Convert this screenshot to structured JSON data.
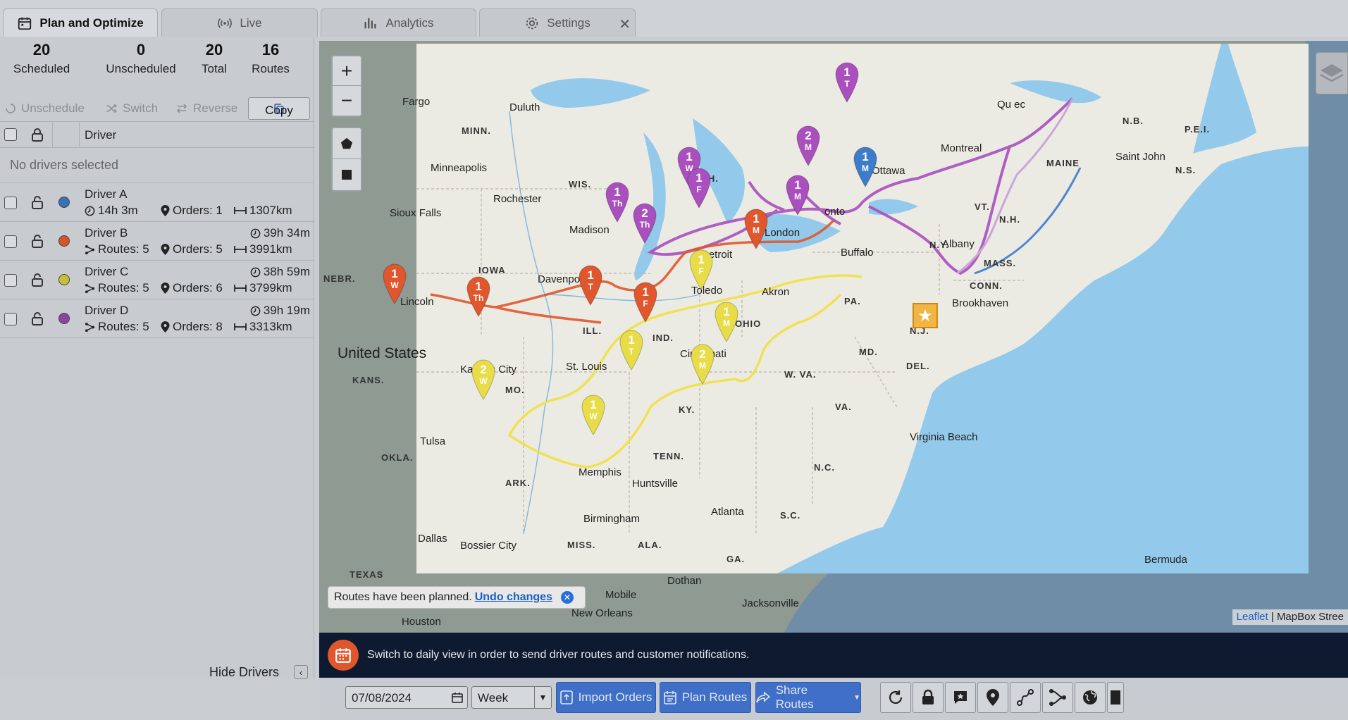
{
  "tabs": [
    {
      "label": "Plan and Optimize",
      "icon": "calendar-icon"
    },
    {
      "label": "Live",
      "icon": "broadcast-icon"
    },
    {
      "label": "Analytics",
      "icon": "bar-chart-icon"
    },
    {
      "label": "Settings",
      "icon": "gear-icon"
    }
  ],
  "stats": [
    {
      "value": "20",
      "label": "Scheduled"
    },
    {
      "value": "0",
      "label": "Unscheduled"
    },
    {
      "value": "20",
      "label": "Total"
    },
    {
      "value": "16",
      "label": "Routes"
    }
  ],
  "actions": {
    "unschedule": "Unschedule",
    "switch": "Switch",
    "reverse": "Reverse",
    "copy": "Copy"
  },
  "table": {
    "driver_header": "Driver",
    "no_selection": "No drivers selected"
  },
  "drivers": [
    {
      "name": "Driver A",
      "color": "#3b6fb6",
      "time": "14h 3m",
      "orders": "Orders: 1",
      "distance": "1307km",
      "routes": ""
    },
    {
      "name": "Driver B",
      "color": "#d6542c",
      "time": "39h 34m",
      "orders": "Orders: 5",
      "distance": "3991km",
      "routes": "Routes: 5"
    },
    {
      "name": "Driver C",
      "color": "#c9be3a",
      "time": "38h 59m",
      "orders": "Orders: 6",
      "distance": "3799km",
      "routes": "Routes: 5"
    },
    {
      "name": "Driver D",
      "color": "#8e43a3",
      "time": "39h 19m",
      "orders": "Orders: 8",
      "distance": "3313km",
      "routes": "Routes: 5"
    }
  ],
  "hide_drivers": "Hide Drivers",
  "map": {
    "zoom_in": "+",
    "zoom_out": "−",
    "country_label": "United States",
    "toast_text": "Routes have been planned.",
    "toast_link": "Undo changes",
    "attribution_link": "Leaflet",
    "attribution_text": "| MapBox Stree",
    "labels": {
      "fargo": "Fargo",
      "duluth": "Duluth",
      "minn": "MINN.",
      "minneapolis": "Minneapolis",
      "wis": "WIS.",
      "mich": "MICH.",
      "rochester": "Rochester",
      "madison": "Madison",
      "sioux_falls": "Sioux Falls",
      "iowa": "IOWA",
      "davenport": "Davenport",
      "nebr": "NEBR.",
      "lincoln": "Lincoln",
      "ill": "ILL.",
      "ind": "IND.",
      "ohio": "OHIO",
      "detroit": "Detroit",
      "toledo": "Toledo",
      "akron": "Akron",
      "london": "London",
      "toronto": "onto",
      "buffalo": "Buffalo",
      "ottawa": "Ottawa",
      "montreal": "Montreal",
      "quebec": "Qu  ec",
      "maine": "MAINE",
      "nb": "N.B.",
      "pei": "P.E.I.",
      "saint_john": "Saint John",
      "ns": "N.S.",
      "vt": "VT.",
      "nh": "N.H.",
      "ny": "N.Y.",
      "albany": "Albany",
      "mass": "MASS.",
      "conn": "CONN.",
      "brookhaven": "Brookhaven",
      "pa": "PA.",
      "nj": "N.J.",
      "md": "MD.",
      "del": "DEL.",
      "wva": "W. VA.",
      "va": "VA.",
      "kansas_city": "Kansas City",
      "kans": "KANS.",
      "mo": "MO.",
      "st_louis": "St. Louis",
      "cincinnati": "Cincinnati",
      "ky": "KY.",
      "tenn": "TENN.",
      "tulsa": "Tulsa",
      "okla": "OKLA.",
      "ark": "ARK.",
      "memphis": "Memphis",
      "huntsville": "Huntsville",
      "birmingham": "Birmingham",
      "atlanta": "Atlanta",
      "nc": "N.C.",
      "sc": "S.C.",
      "virginia_beach": "Virginia Beach",
      "dallas": "Dallas",
      "bossier_city": "Bossier City",
      "miss": "MISS.",
      "ala": "ALA.",
      "ga": "GA.",
      "texas": "TEXAS",
      "dothan": "Dothan",
      "mobile": "Mobile",
      "jacksonville": "Jacksonville",
      "houston": "Houston",
      "new_orleans": "New Orleans",
      "bermuda": "Bermuda"
    },
    "markers": [
      {
        "num": "1",
        "day": "T",
        "color": "#a94fbe"
      },
      {
        "num": "2",
        "day": "M",
        "color": "#a94fbe"
      },
      {
        "num": "1",
        "day": "M",
        "color": "#3d7cc9"
      },
      {
        "num": "1",
        "day": "W",
        "color": "#a94fbe"
      },
      {
        "num": "1",
        "day": "F",
        "color": "#a94fbe"
      },
      {
        "num": "1",
        "day": "M",
        "color": "#a94fbe"
      },
      {
        "num": "1",
        "day": "Th",
        "color": "#a94fbe"
      },
      {
        "num": "2",
        "day": "Th",
        "color": "#a94fbe"
      },
      {
        "num": "1",
        "day": "M",
        "color": "#e0562d"
      },
      {
        "num": "1",
        "day": "F",
        "color": "#e8dc48"
      },
      {
        "num": "1",
        "day": "W",
        "color": "#e0562d"
      },
      {
        "num": "1",
        "day": "Th",
        "color": "#e0562d"
      },
      {
        "num": "1",
        "day": "T",
        "color": "#e0562d"
      },
      {
        "num": "1",
        "day": "F",
        "color": "#e0562d"
      },
      {
        "num": "1",
        "day": "M",
        "color": "#e8dc48"
      },
      {
        "num": "1",
        "day": "T",
        "color": "#e8dc48"
      },
      {
        "num": "2",
        "day": "M",
        "color": "#e8dc48"
      },
      {
        "num": "2",
        "day": "W",
        "color": "#e8dc48"
      },
      {
        "num": "1",
        "day": "W",
        "color": "#e8dc48"
      }
    ]
  },
  "banner": {
    "text": "Switch to daily view in order to send driver routes and customer notifications."
  },
  "toolbar": {
    "date": "07/08/2024",
    "period": "Week",
    "import_orders": "Import Orders",
    "plan_routes": "Plan Routes",
    "share_routes": "Share Routes"
  }
}
